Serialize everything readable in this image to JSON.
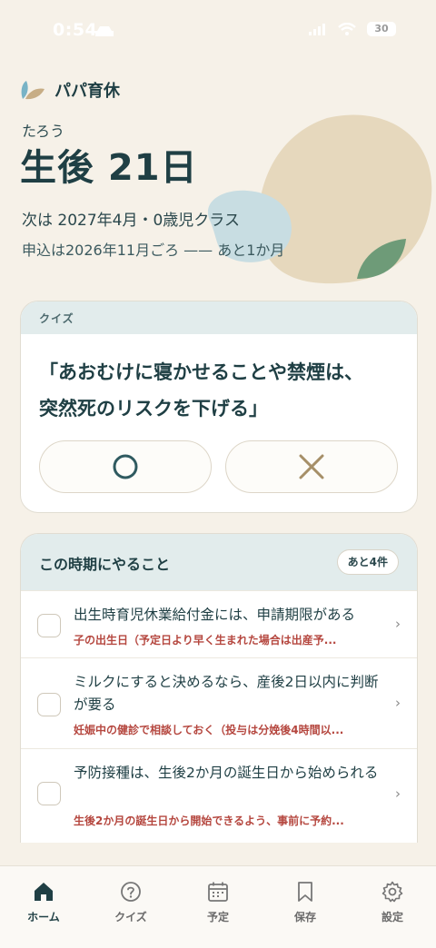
{
  "status": {
    "time": "0:54",
    "battery": "30"
  },
  "app": {
    "name": "パパ育休"
  },
  "child": {
    "name": "たろう",
    "age_label": "生後 21日"
  },
  "schedule": {
    "next": "次は 2027年4月・0歳児クラス",
    "apply": "申込は2026年11月ごろ —— あと1か月"
  },
  "quiz": {
    "header": "クイズ",
    "question": "「あおむけに寝かせることや禁煙は、突然死のリスクを下げる」",
    "options": [
      {
        "label": "〇",
        "icon": "circle-icon"
      },
      {
        "label": "×",
        "icon": "cross-icon"
      }
    ]
  },
  "todos": {
    "title": "この時期にやること",
    "remaining": "あと4件",
    "items": [
      {
        "text": "出生時育児休業給付金には、申請期限がある",
        "sub": "子の出生日（予定日より早く生まれた場合は出産予..."
      },
      {
        "text": "ミルクにすると決めるなら、産後2日以内に判断が要る",
        "sub": "妊娠中の健診で相談しておく（投与は分娩後4時間以..."
      },
      {
        "text": "予防接種は、生後2か月の誕生日から始められる",
        "sub": "生後2か月の誕生日から開始できるよう、事前に予約..."
      }
    ]
  },
  "tabs": [
    {
      "label": "ホーム",
      "icon": "home-icon",
      "active": true
    },
    {
      "label": "クイズ",
      "icon": "question-icon",
      "active": false
    },
    {
      "label": "予定",
      "icon": "calendar-icon",
      "active": false
    },
    {
      "label": "保存",
      "icon": "bookmark-icon",
      "active": false
    },
    {
      "label": "設定",
      "icon": "gear-icon",
      "active": false
    }
  ],
  "colors": {
    "background": "#f6f1e8",
    "primary": "#1f3f44",
    "accent_red": "#b5473f",
    "sand_blob": "#e6d8bd",
    "blue_blob": "#c8dde2",
    "leaf_green": "#6e9b78"
  }
}
